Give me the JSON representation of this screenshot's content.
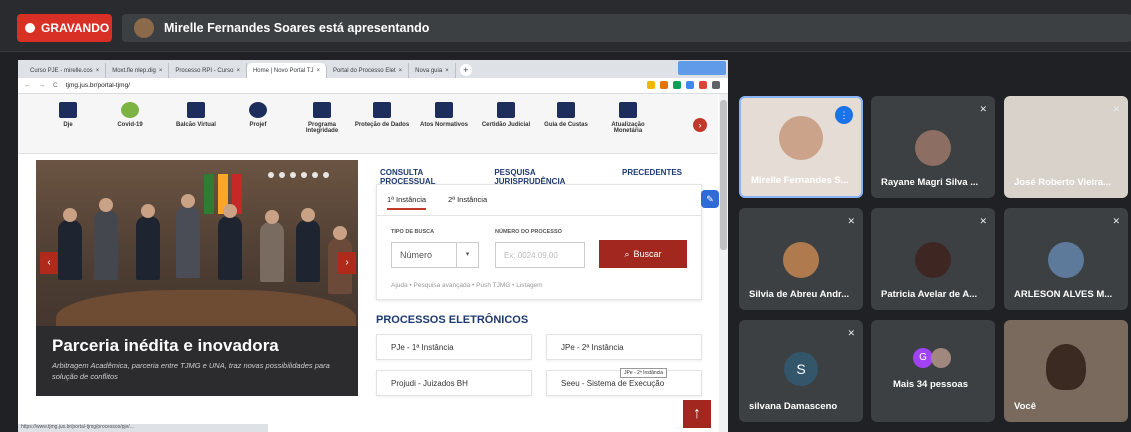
{
  "meet": {
    "recording_label": "GRAVANDO",
    "presenting_text": "Mirelle Fernandes Soares está apresentando"
  },
  "browser": {
    "tabs": [
      {
        "label": "Curso PJE - mirelle.cos",
        "active": false
      },
      {
        "label": "Moxt.fle nlep.dig",
        "active": false
      },
      {
        "label": "Processo RPI - Curso",
        "active": false
      },
      {
        "label": "Home | Novo Portal TJ",
        "active": true
      },
      {
        "label": "Portal do Processo Elet",
        "active": false
      },
      {
        "label": "Nova guia",
        "active": false
      }
    ],
    "url": "tjmg.jus.br/portal-tjmg/",
    "status_url": "https://www.tjmg.jus.br/portal-tjmg/processos/pje/..."
  },
  "site_nav": [
    {
      "label": "Dje",
      "icon": "book-icon"
    },
    {
      "label": "Covid-19",
      "icon": "virus-icon"
    },
    {
      "label": "Balcão Virtual",
      "icon": "monitor-icon"
    },
    {
      "label": "Projef",
      "icon": "hexagon-icon"
    },
    {
      "label": "Programa Integridade",
      "icon": "puzzle-icon"
    },
    {
      "label": "Proteção de Dados",
      "icon": "lock-icon"
    },
    {
      "label": "Atos Normativos",
      "icon": "document-icon"
    },
    {
      "label": "Certidão Judicial",
      "icon": "certificate-icon"
    },
    {
      "label": "Guia de Custas",
      "icon": "receipt-icon"
    },
    {
      "label": "Atualização Monetária",
      "icon": "dollar-icon"
    }
  ],
  "hero": {
    "title": "Parceria inédita e inovadora",
    "subtitle": "Arbitragem Acadêmica, parceria entre TJMG e UNA, traz novas possibilidades para solução de conflitos",
    "prev": "‹",
    "next": "›"
  },
  "consulta": {
    "tabs": [
      "CONSULTA PROCESSUAL",
      "PESQUISA JURISPRUDÊNCIA",
      "PRECEDENTES"
    ],
    "subtabs": [
      "1ª Instância",
      "2ª Instância"
    ],
    "tipo_label": "TIPO DE BUSCA",
    "tipo_value": "Número",
    "numero_label": "NÚMERO DO PROCESSO",
    "numero_placeholder": "Ex: 0024.09.00",
    "buscar_label": "Buscar",
    "links": "Ajuda  •  Pesquisa avançada  •  Push TJMG  •  Listagem"
  },
  "processos": {
    "title": "PROCESSOS ELETRÔNICOS",
    "items": [
      "PJe - 1ª Instância",
      "JPe - 2ª Instância",
      "Projudi - Juizados BH",
      "Seeu - Sistema de Execução"
    ],
    "tooltip": "JPe - 2ª Instância"
  },
  "participants": [
    {
      "name": "Mirelle Fernandes S...",
      "speaking": true
    },
    {
      "name": "Rayane Magri Silva ...",
      "muted": true
    },
    {
      "name": "José Roberto Vieira...",
      "muted": true
    },
    {
      "name": "Silvia de Abreu Andr...",
      "muted": true
    },
    {
      "name": "Patricia Avelar de A...",
      "muted": true
    },
    {
      "name": "ARLESON ALVES M...",
      "muted": true
    },
    {
      "name": "silvana Damasceno",
      "initial": "S",
      "muted": true
    },
    {
      "name": "Mais 34 pessoas",
      "initial": "G"
    },
    {
      "name": "Você"
    }
  ]
}
